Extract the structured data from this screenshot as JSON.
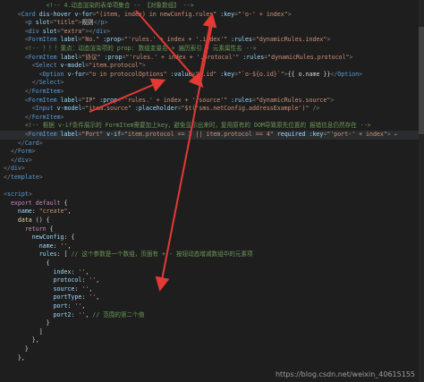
{
  "lines": [
    {
      "indent": 0,
      "highlight": false,
      "tokens": [
        {
          "t": "pun",
          "v": "            "
        },
        {
          "t": "cmt",
          "v": "<!-- 4.动态渲染的表单项集合 -- 【对象数组】 -->"
        }
      ]
    },
    {
      "indent": 0,
      "highlight": false,
      "tokens": [
        {
          "t": "pun",
          "v": "    "
        },
        {
          "t": "pun",
          "v": "<"
        },
        {
          "t": "tag",
          "v": "Card"
        },
        {
          "t": "attr",
          "v": " dis-hover"
        },
        {
          "t": "attr",
          "v": " v-for"
        },
        {
          "t": "pun",
          "v": "="
        },
        {
          "t": "str",
          "v": "\"(item, index) in newConfig.rules\""
        },
        {
          "t": "attr",
          "v": " :key"
        },
        {
          "t": "pun",
          "v": "="
        },
        {
          "t": "str",
          "v": "\"'o-' + index\""
        },
        {
          "t": "pun",
          "v": ">"
        }
      ]
    },
    {
      "indent": 0,
      "highlight": false,
      "tokens": [
        {
          "t": "pun",
          "v": "      <"
        },
        {
          "t": "tag",
          "v": "p"
        },
        {
          "t": "attr",
          "v": " slot"
        },
        {
          "t": "pun",
          "v": "="
        },
        {
          "t": "str",
          "v": "\"title\""
        },
        {
          "t": "pun",
          "v": ">"
        },
        {
          "t": "txt",
          "v": "规则"
        },
        {
          "t": "pun",
          "v": "</"
        },
        {
          "t": "tag",
          "v": "p"
        },
        {
          "t": "pun",
          "v": ">"
        }
      ]
    },
    {
      "indent": 0,
      "highlight": false,
      "tokens": [
        {
          "t": "pun",
          "v": "      <"
        },
        {
          "t": "tag",
          "v": "div"
        },
        {
          "t": "attr",
          "v": " slot"
        },
        {
          "t": "pun",
          "v": "="
        },
        {
          "t": "str",
          "v": "\"extra\""
        },
        {
          "t": "pun",
          "v": "></"
        },
        {
          "t": "tag",
          "v": "div"
        },
        {
          "t": "pun",
          "v": ">"
        }
      ]
    },
    {
      "indent": 0,
      "highlight": false,
      "tokens": [
        {
          "t": "pun",
          "v": "      <"
        },
        {
          "t": "tag",
          "v": "FormItem"
        },
        {
          "t": "attr",
          "v": " label"
        },
        {
          "t": "pun",
          "v": "="
        },
        {
          "t": "str",
          "v": "\"No.\""
        },
        {
          "t": "attr",
          "v": " :prop"
        },
        {
          "t": "pun",
          "v": "="
        },
        {
          "t": "str",
          "v": "\"'rules.' + index + '.index'\""
        },
        {
          "t": "attr",
          "v": " :rules"
        },
        {
          "t": "pun",
          "v": "="
        },
        {
          "t": "str",
          "v": "\"dynamicRules.index\""
        },
        {
          "t": "pun",
          "v": ">"
        }
      ]
    },
    {
      "indent": 0,
      "highlight": false,
      "tokens": [
        {
          "t": "pun",
          "v": "      "
        },
        {
          "t": "cmt",
          "v": "<!-- ！！！重点：动态渲染项的 prop: 数组变量名 + 遍历索引 + 元素属性名 -->"
        }
      ]
    },
    {
      "indent": 0,
      "highlight": false,
      "tokens": [
        {
          "t": "pun",
          "v": "      <"
        },
        {
          "t": "tag",
          "v": "FormItem"
        },
        {
          "t": "attr",
          "v": " label"
        },
        {
          "t": "pun",
          "v": "="
        },
        {
          "t": "str",
          "v": "\"协议\""
        },
        {
          "t": "attr",
          "v": " :prop"
        },
        {
          "t": "pun",
          "v": "="
        },
        {
          "t": "str",
          "v": "\"'rules.' + index + '.protocol'\""
        },
        {
          "t": "attr",
          "v": " :rules"
        },
        {
          "t": "pun",
          "v": "="
        },
        {
          "t": "str",
          "v": "\"dynamicRules.protocol\""
        },
        {
          "t": "pun",
          "v": ">"
        }
      ]
    },
    {
      "indent": 0,
      "highlight": false,
      "tokens": [
        {
          "t": "pun",
          "v": "        <"
        },
        {
          "t": "tag",
          "v": "Select"
        },
        {
          "t": "attr",
          "v": " v-model"
        },
        {
          "t": "pun",
          "v": "="
        },
        {
          "t": "str",
          "v": "\"item.protocol\""
        },
        {
          "t": "pun",
          "v": ">"
        }
      ]
    },
    {
      "indent": 0,
      "highlight": false,
      "tokens": [
        {
          "t": "pun",
          "v": "          <"
        },
        {
          "t": "tag",
          "v": "Option"
        },
        {
          "t": "attr",
          "v": " v-for"
        },
        {
          "t": "pun",
          "v": "="
        },
        {
          "t": "str",
          "v": "\"o in protocolOptions\""
        },
        {
          "t": "attr",
          "v": " :value"
        },
        {
          "t": "pun",
          "v": "="
        },
        {
          "t": "str",
          "v": "\"o.id\""
        },
        {
          "t": "attr",
          "v": " :key"
        },
        {
          "t": "pun",
          "v": "="
        },
        {
          "t": "str",
          "v": "\"`o-${o.id}`\""
        },
        {
          "t": "pun",
          "v": ">"
        },
        {
          "t": "txt",
          "v": "{{ o.name }}"
        },
        {
          "t": "pun",
          "v": "</"
        },
        {
          "t": "tag",
          "v": "Option"
        },
        {
          "t": "pun",
          "v": ">"
        }
      ]
    },
    {
      "indent": 0,
      "highlight": false,
      "tokens": [
        {
          "t": "pun",
          "v": "        </"
        },
        {
          "t": "tag",
          "v": "Select"
        },
        {
          "t": "pun",
          "v": ">"
        }
      ]
    },
    {
      "indent": 0,
      "highlight": false,
      "tokens": [
        {
          "t": "pun",
          "v": "      </"
        },
        {
          "t": "tag",
          "v": "FormItem"
        },
        {
          "t": "pun",
          "v": ">"
        }
      ]
    },
    {
      "indent": 0,
      "highlight": false,
      "tokens": [
        {
          "t": "pun",
          "v": "      <"
        },
        {
          "t": "tag",
          "v": "FormItem"
        },
        {
          "t": "attr",
          "v": " label"
        },
        {
          "t": "pun",
          "v": "="
        },
        {
          "t": "str",
          "v": "\"IP\""
        },
        {
          "t": "attr",
          "v": " :prop"
        },
        {
          "t": "pun",
          "v": "="
        },
        {
          "t": "str",
          "v": "\"'rules.' + index + '.source'\""
        },
        {
          "t": "attr",
          "v": " :rules"
        },
        {
          "t": "pun",
          "v": "="
        },
        {
          "t": "str",
          "v": "\"dynamicRules.source\""
        },
        {
          "t": "pun",
          "v": ">"
        }
      ]
    },
    {
      "indent": 0,
      "highlight": false,
      "tokens": [
        {
          "t": "pun",
          "v": "        <"
        },
        {
          "t": "tag",
          "v": "Input"
        },
        {
          "t": "attr",
          "v": " v-model"
        },
        {
          "t": "pun",
          "v": "="
        },
        {
          "t": "str",
          "v": "\"item.source\""
        },
        {
          "t": "attr",
          "v": " :placeholder"
        },
        {
          "t": "pun",
          "v": "="
        },
        {
          "t": "str",
          "v": "\"$t('sms.netConfig.addressExample')\""
        },
        {
          "t": "pun",
          "v": " />"
        }
      ]
    },
    {
      "indent": 0,
      "highlight": false,
      "tokens": [
        {
          "t": "pun",
          "v": "      </"
        },
        {
          "t": "tag",
          "v": "FormItem"
        },
        {
          "t": "pun",
          "v": ">"
        }
      ]
    },
    {
      "indent": 0,
      "highlight": false,
      "tokens": [
        {
          "t": "pun",
          "v": "      "
        },
        {
          "t": "cmt",
          "v": "<!-- 根据 v-if条件展示的 FormItem需要加上key，避免显示出来时，复用原有的 DOM导致原先位置的 报错信息仍然存在 -->"
        }
      ]
    },
    {
      "indent": 0,
      "highlight": true,
      "tokens": [
        {
          "t": "pun",
          "v": "      <"
        },
        {
          "t": "tag",
          "v": "FormItem"
        },
        {
          "t": "attr",
          "v": " label"
        },
        {
          "t": "pun",
          "v": "="
        },
        {
          "t": "str",
          "v": "\"Port\""
        },
        {
          "t": "attr",
          "v": " v-if"
        },
        {
          "t": "pun",
          "v": "="
        },
        {
          "t": "str",
          "v": "\"item.protocol == 3 || item.protocol == 4\""
        },
        {
          "t": "attr",
          "v": " required"
        },
        {
          "t": "attr",
          "v": " :key"
        },
        {
          "t": "pun",
          "v": "="
        },
        {
          "t": "str",
          "v": "\"'port-' + index\""
        },
        {
          "t": "pun",
          "v": "> ▸"
        }
      ]
    },
    {
      "indent": 0,
      "highlight": false,
      "tokens": [
        {
          "t": "pun",
          "v": "    </"
        },
        {
          "t": "tag",
          "v": "Card"
        },
        {
          "t": "pun",
          "v": ">"
        }
      ]
    },
    {
      "indent": 0,
      "highlight": false,
      "tokens": [
        {
          "t": "pun",
          "v": "  </"
        },
        {
          "t": "tag",
          "v": "Form"
        },
        {
          "t": "pun",
          "v": ">"
        }
      ]
    },
    {
      "indent": 0,
      "highlight": false,
      "tokens": [
        {
          "t": "pun",
          "v": "  </"
        },
        {
          "t": "tag",
          "v": "div"
        },
        {
          "t": "pun",
          "v": ">"
        }
      ]
    },
    {
      "indent": 0,
      "highlight": false,
      "tokens": [
        {
          "t": "pun",
          "v": "</"
        },
        {
          "t": "tag",
          "v": "div"
        },
        {
          "t": "pun",
          "v": ">"
        }
      ]
    },
    {
      "indent": 0,
      "highlight": false,
      "tokens": [
        {
          "t": "pun",
          "v": "</"
        },
        {
          "t": "tag",
          "v": "template"
        },
        {
          "t": "pun",
          "v": ">"
        }
      ]
    },
    {
      "indent": 0,
      "highlight": false,
      "tokens": []
    },
    {
      "indent": 0,
      "highlight": false,
      "tokens": [
        {
          "t": "pun",
          "v": "<"
        },
        {
          "t": "tag",
          "v": "script"
        },
        {
          "t": "pun",
          "v": ">"
        }
      ]
    },
    {
      "indent": 0,
      "highlight": false,
      "tokens": [
        {
          "t": "kw",
          "v": "  export default"
        },
        {
          "t": "txt",
          "v": " {"
        }
      ]
    },
    {
      "indent": 0,
      "highlight": false,
      "tokens": [
        {
          "t": "attr",
          "v": "    name"
        },
        {
          "t": "txt",
          "v": ": "
        },
        {
          "t": "str",
          "v": "\"create\""
        },
        {
          "t": "txt",
          "v": ","
        }
      ]
    },
    {
      "indent": 0,
      "highlight": false,
      "tokens": [
        {
          "t": "fn",
          "v": "    data"
        },
        {
          "t": "txt",
          "v": " () {"
        }
      ]
    },
    {
      "indent": 0,
      "highlight": false,
      "tokens": [
        {
          "t": "kw",
          "v": "      return"
        },
        {
          "t": "txt",
          "v": " {"
        }
      ]
    },
    {
      "indent": 0,
      "highlight": false,
      "tokens": [
        {
          "t": "attr",
          "v": "        newConfig"
        },
        {
          "t": "txt",
          "v": ": {"
        }
      ]
    },
    {
      "indent": 0,
      "highlight": false,
      "tokens": [
        {
          "t": "attr",
          "v": "          name"
        },
        {
          "t": "txt",
          "v": ": "
        },
        {
          "t": "str",
          "v": "''"
        },
        {
          "t": "txt",
          "v": ","
        }
      ]
    },
    {
      "indent": 0,
      "highlight": false,
      "tokens": [
        {
          "t": "attr",
          "v": "          rules"
        },
        {
          "t": "txt",
          "v": ": [ "
        },
        {
          "t": "cmt",
          "v": "// 这个参数是一个数组，页面有 + - 按钮动态增减数组中的元素项"
        }
      ]
    },
    {
      "indent": 0,
      "highlight": false,
      "tokens": [
        {
          "t": "txt",
          "v": "            {"
        }
      ]
    },
    {
      "indent": 0,
      "highlight": false,
      "tokens": [
        {
          "t": "attr",
          "v": "              index"
        },
        {
          "t": "txt",
          "v": ": "
        },
        {
          "t": "str",
          "v": "''"
        },
        {
          "t": "txt",
          "v": ","
        }
      ]
    },
    {
      "indent": 0,
      "highlight": false,
      "tokens": [
        {
          "t": "attr",
          "v": "              protocol"
        },
        {
          "t": "txt",
          "v": ": "
        },
        {
          "t": "str",
          "v": "''"
        },
        {
          "t": "txt",
          "v": ","
        }
      ]
    },
    {
      "indent": 0,
      "highlight": false,
      "tokens": [
        {
          "t": "attr",
          "v": "              source"
        },
        {
          "t": "txt",
          "v": ": "
        },
        {
          "t": "str",
          "v": "''"
        },
        {
          "t": "txt",
          "v": ","
        }
      ]
    },
    {
      "indent": 0,
      "highlight": false,
      "tokens": [
        {
          "t": "attr",
          "v": "              portType"
        },
        {
          "t": "txt",
          "v": ": "
        },
        {
          "t": "str",
          "v": "''"
        },
        {
          "t": "txt",
          "v": ","
        }
      ]
    },
    {
      "indent": 0,
      "highlight": false,
      "tokens": [
        {
          "t": "attr",
          "v": "              port"
        },
        {
          "t": "txt",
          "v": ": "
        },
        {
          "t": "str",
          "v": "''"
        },
        {
          "t": "txt",
          "v": ","
        }
      ]
    },
    {
      "indent": 0,
      "highlight": false,
      "tokens": [
        {
          "t": "attr",
          "v": "              port2"
        },
        {
          "t": "txt",
          "v": ": "
        },
        {
          "t": "str",
          "v": "''"
        },
        {
          "t": "txt",
          "v": ", "
        },
        {
          "t": "cmt",
          "v": "// 范围的第二个值"
        }
      ]
    },
    {
      "indent": 0,
      "highlight": false,
      "tokens": [
        {
          "t": "txt",
          "v": "            }"
        }
      ]
    },
    {
      "indent": 0,
      "highlight": false,
      "tokens": [
        {
          "t": "txt",
          "v": "          ]"
        }
      ]
    },
    {
      "indent": 0,
      "highlight": false,
      "tokens": [
        {
          "t": "txt",
          "v": "        },"
        }
      ]
    },
    {
      "indent": 0,
      "highlight": false,
      "tokens": [
        {
          "t": "txt",
          "v": "      }"
        }
      ]
    },
    {
      "indent": 0,
      "highlight": false,
      "tokens": [
        {
          "t": "txt",
          "v": "    },"
        }
      ]
    }
  ],
  "watermark": "https://blog.csdn.net/weixin_40615155",
  "colors": {
    "background": "#1e1e1e",
    "annotation": "#e53935"
  }
}
